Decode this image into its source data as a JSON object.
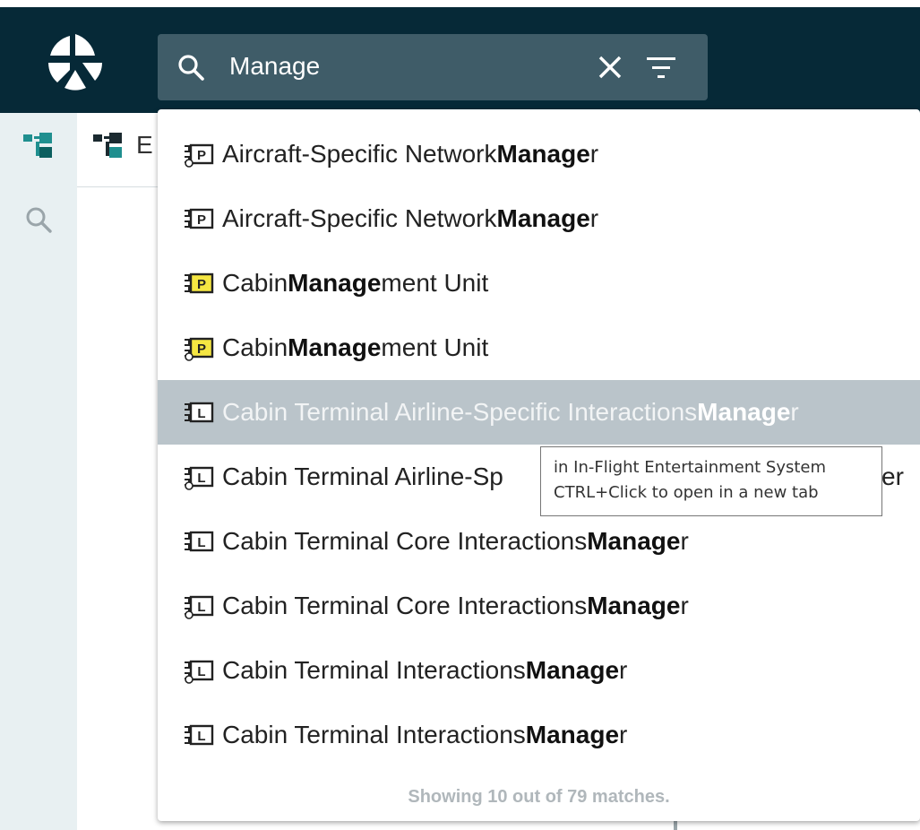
{
  "search": {
    "query": "Manage"
  },
  "icons": {
    "logo": "app-logo",
    "search": "search-icon",
    "clear": "close-icon",
    "filter": "filter-icon",
    "tree": "tree-icon",
    "package": "package-icon",
    "library": "library-icon"
  },
  "panel": {
    "title": "E"
  },
  "results": [
    {
      "prefix": "Aircraft-Specific Network ",
      "match": "Manage",
      "suffix": "r",
      "icon": "package",
      "variant": "outline",
      "color": "#ffffff",
      "highlighted": false
    },
    {
      "prefix": "Aircraft-Specific Network ",
      "match": "Manage",
      "suffix": "r",
      "icon": "package",
      "variant": "plain",
      "color": "#ffffff",
      "highlighted": false
    },
    {
      "prefix": "Cabin ",
      "match": "Manage",
      "suffix": "ment Unit",
      "icon": "package",
      "variant": "plain",
      "color": "#f5e642",
      "highlighted": false
    },
    {
      "prefix": "Cabin ",
      "match": "Manage",
      "suffix": "ment Unit",
      "icon": "package",
      "variant": "outline",
      "color": "#f5e642",
      "highlighted": false
    },
    {
      "prefix": "Cabin Terminal Airline-Specific Interactions ",
      "match": "Manage",
      "suffix": "r",
      "icon": "library",
      "variant": "plain",
      "color": "#ffffff",
      "highlighted": true
    },
    {
      "prefix": "Cabin Terminal Airline-Sp",
      "match": "",
      "suffix": "",
      "tail": "er",
      "icon": "library",
      "variant": "outline",
      "color": "#ffffff",
      "highlighted": false
    },
    {
      "prefix": "Cabin Terminal Core Interactions ",
      "match": "Manage",
      "suffix": "r",
      "icon": "library",
      "variant": "plain",
      "color": "#ffffff",
      "highlighted": false
    },
    {
      "prefix": "Cabin Terminal Core Interactions ",
      "match": "Manage",
      "suffix": "r",
      "icon": "library",
      "variant": "outline",
      "color": "#ffffff",
      "highlighted": false
    },
    {
      "prefix": "Cabin Terminal Interactions ",
      "match": "Manage",
      "suffix": "r",
      "icon": "library",
      "variant": "outline",
      "color": "#ffffff",
      "highlighted": false
    },
    {
      "prefix": "Cabin Terminal Interactions ",
      "match": "Manage",
      "suffix": "r",
      "icon": "library",
      "variant": "plain",
      "color": "#ffffff",
      "highlighted": false
    }
  ],
  "footer": "Showing 10 out of 79 matches.",
  "tooltip": {
    "line1": "in In-Flight Entertainment System",
    "line2": "CTRL+Click to open in a new tab"
  },
  "colors": {
    "topbar": "#062937",
    "search_box": "#3f5c68",
    "highlight": "#bac4ca",
    "sidebar": "#e8f0f2",
    "tree_accent": "#1f8f8f"
  }
}
